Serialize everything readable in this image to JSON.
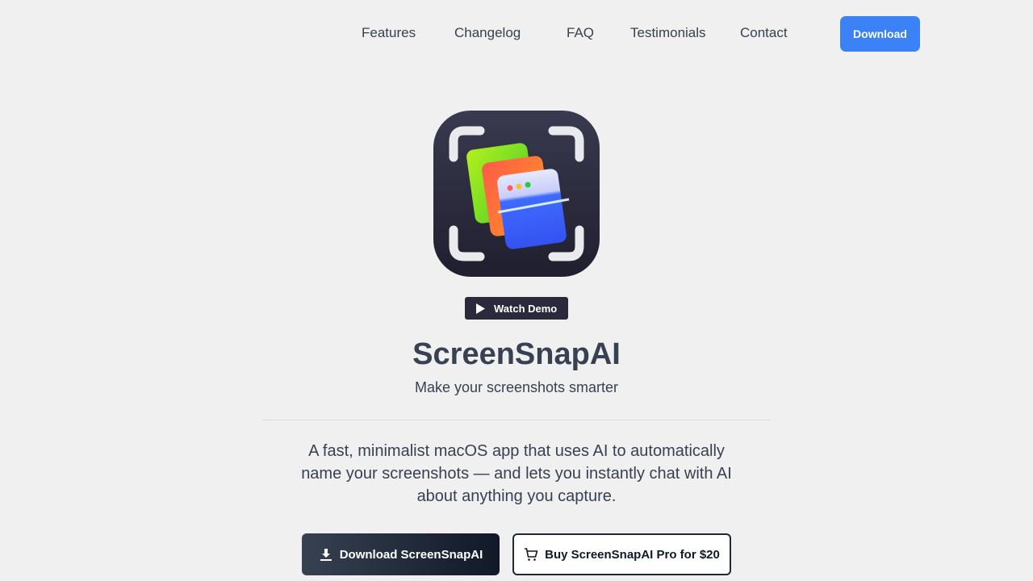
{
  "nav": {
    "links": [
      "Features",
      "Changelog",
      "FAQ",
      "Testimonials",
      "Contact"
    ],
    "download_label": "Download",
    "accent_color": "#3b82f6"
  },
  "hero": {
    "icon": "screenshot-app-icon",
    "watch_demo_label": "Watch Demo",
    "title": "ScreenSnapAI",
    "subtitle": "Make your screenshots smarter",
    "description": "A fast, minimalist macOS app that uses AI to automatically name your screenshots — and lets you instantly chat with AI about anything you capture.",
    "primary_button": {
      "label": "Download ScreenSnapAI",
      "icon": "download-icon"
    },
    "secondary_button": {
      "label": "Buy ScreenSnapAI Pro for $20",
      "icon": "cart-icon"
    }
  }
}
